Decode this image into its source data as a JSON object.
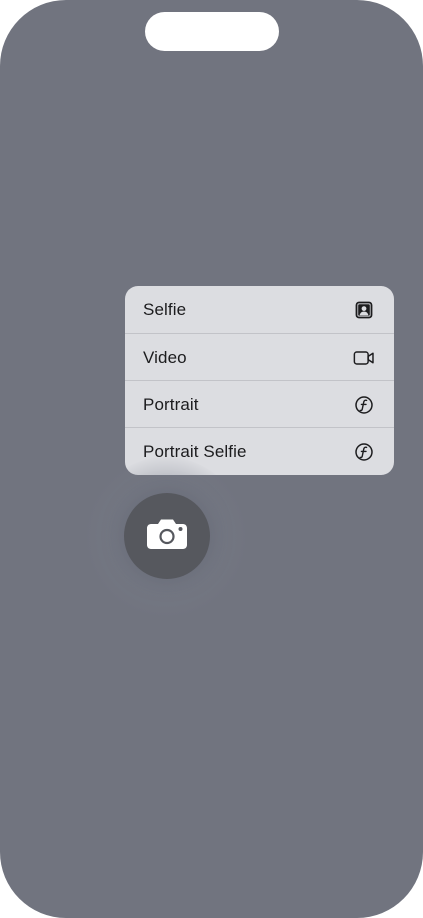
{
  "screen": {
    "background_color": "#71747f",
    "island_color": "#ffffff"
  },
  "camera_menu": {
    "items": [
      {
        "label": "Selfie",
        "icon": "selfie-portrait-icon"
      },
      {
        "label": "Video",
        "icon": "video-camera-icon"
      },
      {
        "label": "Portrait",
        "icon": "aperture-f-icon"
      },
      {
        "label": "Portrait Selfie",
        "icon": "aperture-f-icon"
      }
    ],
    "background_color": "#dcdde1"
  },
  "camera_button": {
    "icon": "camera-icon",
    "background_color": "#56585e"
  }
}
